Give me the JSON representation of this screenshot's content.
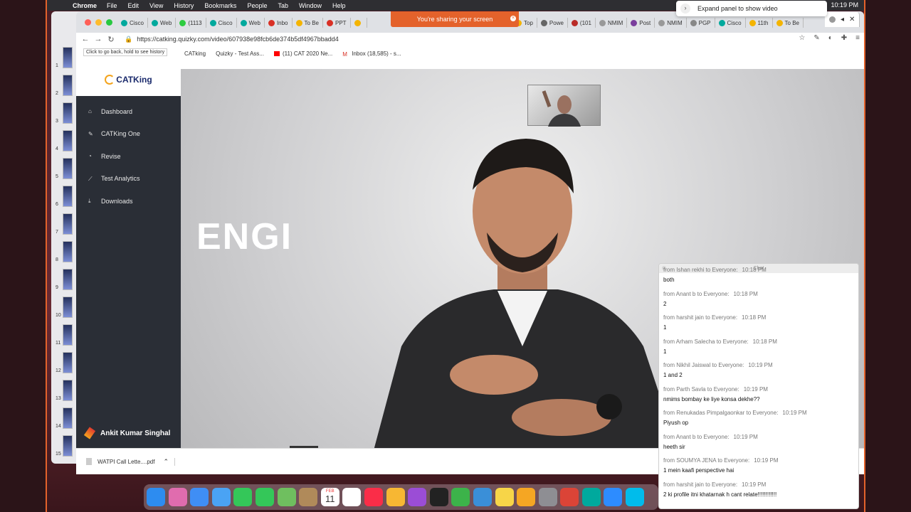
{
  "menubar": {
    "app_name": "Chrome",
    "items": [
      "File",
      "Edit",
      "View",
      "History",
      "Bookmarks",
      "People",
      "Tab",
      "Window",
      "Help"
    ],
    "clock": "10:19 PM"
  },
  "expand_panel": {
    "label": "Expand panel to show video"
  },
  "tabs": [
    {
      "label": "Cisco",
      "color": "#00a99d"
    },
    {
      "label": "Web",
      "color": "#00a99d"
    },
    {
      "label": "(1113",
      "color": "#2ecc40"
    },
    {
      "label": "Cisco",
      "color": "#00a99d"
    },
    {
      "label": "Web",
      "color": "#00a99d"
    },
    {
      "label": "Inbo",
      "color": "#d93025"
    },
    {
      "label": "To Be",
      "color": "#f4b400"
    },
    {
      "label": "PPT",
      "color": "#d93025"
    },
    {
      "label": "",
      "color": "#f4b400"
    }
  ],
  "tabs_right": [
    {
      "label": "Top",
      "color": "#f4b400"
    },
    {
      "label": "Powe",
      "color": "#666"
    },
    {
      "label": "(101",
      "color": "#b92b27"
    },
    {
      "label": "NMIM",
      "color": "#999"
    },
    {
      "label": "Post",
      "color": "#7a3e9d"
    },
    {
      "label": "NMIM",
      "color": "#999"
    },
    {
      "label": "PGP",
      "color": "#888"
    },
    {
      "label": "Cisco",
      "color": "#00a99d"
    },
    {
      "label": "11th",
      "color": "#f4b400"
    },
    {
      "label": "To Be",
      "color": "#f4b400"
    }
  ],
  "sharing_banner": "You're sharing your screen",
  "toolbar": {
    "url": "https://catking.quizky.com/video/607938e98fcb6de374b5df4967bbadd4",
    "back_tooltip": "Click to go back, hold to see history"
  },
  "bookmarks": [
    {
      "label": "CATking"
    },
    {
      "label": "Quizky - Test Ass..."
    },
    {
      "label": "(11) CAT 2020 Ne..."
    },
    {
      "label": "Inbox (18,585) - s..."
    }
  ],
  "sidebar": {
    "logo_text": "CATKing",
    "items": [
      {
        "label": "Dashboard",
        "icon": "home-icon"
      },
      {
        "label": "CATKing One",
        "icon": "edit-icon"
      },
      {
        "label": "Revise",
        "icon": "gauge-icon"
      },
      {
        "label": "Test Analytics",
        "icon": "chart-icon"
      },
      {
        "label": "Downloads",
        "icon": "download-icon"
      }
    ],
    "user_name": "Ankit Kumar Singhal"
  },
  "video": {
    "overlay_text": "ENGI"
  },
  "downloads_bar": {
    "file_name": "WATPI Call Lette....pdf"
  },
  "chat": {
    "title": "Chat",
    "messages": [
      {
        "from": "from Ishan rekhi to Everyone:",
        "time": "10:18 PM",
        "text": "both"
      },
      {
        "from": "from Anant b to Everyone:",
        "time": "10:18 PM",
        "text": "2"
      },
      {
        "from": "from harshit jain to Everyone:",
        "time": "10:18 PM",
        "text": "1"
      },
      {
        "from": "from Arham Salecha to Everyone:",
        "time": "10:18 PM",
        "text": "1"
      },
      {
        "from": "from Nikhil Jaiswal to Everyone:",
        "time": "10:19 PM",
        "text": "1 and 2"
      },
      {
        "from": "from Parth Savla to Everyone:",
        "time": "10:19 PM",
        "text": "nmims bombay ke liye konsa dekhe??"
      },
      {
        "from": "from Renukadas Pimpalgaonkar to Everyone:",
        "time": "10:19 PM",
        "text": "Piyush op"
      },
      {
        "from": "from Anant b to Everyone:",
        "time": "10:19 PM",
        "text": "heeth sir"
      },
      {
        "from": "from SOUMYA JENA to Everyone:",
        "time": "10:19 PM",
        "text": "1 mein kaafi perspective hai"
      },
      {
        "from": "from harshit jain to Everyone:",
        "time": "10:19 PM",
        "text": "2 ki profile itni khatarnak h cant relate!!!!!!!!!!!!"
      }
    ]
  },
  "dock": {
    "apps": [
      {
        "name": "finder-icon",
        "color": "#2d8cf0"
      },
      {
        "name": "launchpad-icon",
        "color": "#e06cae"
      },
      {
        "name": "safari-icon",
        "color": "#3f8ef5"
      },
      {
        "name": "mail-icon",
        "color": "#4aa3f4"
      },
      {
        "name": "facetime-icon",
        "color": "#34c759"
      },
      {
        "name": "messages-icon",
        "color": "#34c759"
      },
      {
        "name": "maps-icon",
        "color": "#6fbf5f"
      },
      {
        "name": "contacts-icon",
        "color": "#b08a5a"
      },
      {
        "name": "calendar-icon",
        "color": "#ffffff"
      },
      {
        "name": "reminders-icon",
        "color": "#ffffff"
      },
      {
        "name": "music-icon",
        "color": "#fa2d48"
      },
      {
        "name": "photos-icon",
        "color": "#f7b733"
      },
      {
        "name": "podcasts-icon",
        "color": "#9b4dd6"
      },
      {
        "name": "tv-icon",
        "color": "#222222"
      },
      {
        "name": "numbers-icon",
        "color": "#3cb34a"
      },
      {
        "name": "keynote-icon",
        "color": "#3a8fd8"
      },
      {
        "name": "notes-icon",
        "color": "#f7d548"
      },
      {
        "name": "pages-icon",
        "color": "#f5a623"
      },
      {
        "name": "system-preferences-icon",
        "color": "#8e8e93"
      },
      {
        "name": "chrome-icon",
        "color": "#db4437"
      },
      {
        "name": "webex-icon",
        "color": "#00a99d"
      },
      {
        "name": "zoom-icon",
        "color": "#2d8cff"
      },
      {
        "name": "webex-meetings-icon",
        "color": "#00bceb"
      }
    ]
  },
  "calendar_day": "11",
  "calendar_month": "FEB"
}
